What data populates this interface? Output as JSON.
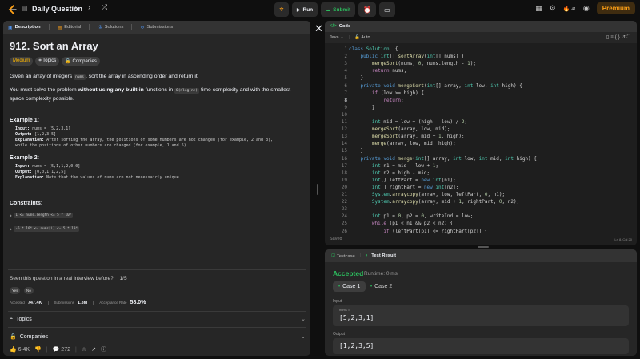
{
  "topbar": {
    "title": "Daily Question",
    "run_label": "Run",
    "submit_label": "Submit",
    "premium_label": "Premium",
    "streak_count": "41"
  },
  "left_tabs": [
    "Description",
    "Editorial",
    "Solutions",
    "Submissions"
  ],
  "problem": {
    "title": "912. Sort an Array",
    "difficulty": "Medium",
    "topics_label": "Topics",
    "companies_label": "Companies",
    "p1_a": "Given an array of integers ",
    "p1_code": "nums",
    "p1_b": ", sort the array in ascending order and return it.",
    "p2_a": "You must solve the problem ",
    "p2_bold": "without using any built-in",
    "p2_b": " functions in ",
    "p2_code": "O(nlog(n))",
    "p2_c": " time complexity and with the smallest space complexity possible.",
    "example1": {
      "heading": "Example 1:",
      "input_label": "Input:",
      "input": " nums = [5,2,3,1]",
      "output_label": "Output:",
      "output": " [1,2,3,5]",
      "explanation_label": "Explanation:",
      "explanation": " After sorting the array, the positions of some numbers are not changed (for example, 2 and 3),",
      "explanation2": "while the positions of other numbers are changed (for example, 1 and 5)."
    },
    "example2": {
      "heading": "Example 2:",
      "input_label": "Input:",
      "input": " nums = [5,1,1,2,0,0]",
      "output_label": "Output:",
      "output": " [0,0,1,1,2,5]",
      "explanation_label": "Explanation:",
      "explanation": " Note that the values of nums are not necessairly unique."
    },
    "constraints_heading": "Constraints:",
    "constraints": [
      "1 <= nums.length <= 5 * 10⁴",
      "-5 * 10⁴ <= nums[i] <= 5 * 10⁴"
    ],
    "seen_text": "Seen this question in a real interview before?",
    "seen_count": "1/5",
    "yes_label": "Yes",
    "no_label": "No",
    "accepted_label": "Accepted",
    "accepted_value": "747.4K",
    "submissions_label": "Submissions",
    "submissions_value": "1.3M",
    "rate_label": "Acceptance Rate",
    "rate_value": "58.0%",
    "topics_section": "Topics",
    "companies_section": "Companies",
    "likes": "6.4K",
    "comments": "272"
  },
  "editor": {
    "tab_label": "Code",
    "language": "Java",
    "autocomplete": "Auto",
    "status": "Saved",
    "cursor": "Ln 8, Col 20",
    "lines": [
      [
        [
          "k",
          "class "
        ],
        [
          "t",
          "Solution"
        ],
        [
          "",
          "  {"
        ]
      ],
      [
        [
          "",
          "    "
        ],
        [
          "k",
          "public "
        ],
        [
          "t",
          "int"
        ],
        [
          "",
          "[] "
        ],
        [
          "f",
          "sortArray"
        ],
        [
          "",
          "("
        ],
        [
          "t",
          "int"
        ],
        [
          "",
          "[] nums) {"
        ]
      ],
      [
        [
          "",
          "        "
        ],
        [
          "f",
          "mergeSort"
        ],
        [
          "",
          "(nums, "
        ],
        [
          "n",
          "0"
        ],
        [
          "",
          ", nums.length - "
        ],
        [
          "n",
          "1"
        ],
        [
          "",
          ");"
        ]
      ],
      [
        [
          "",
          "        "
        ],
        [
          "p",
          "return"
        ],
        [
          "",
          " nums;"
        ]
      ],
      [
        [
          "",
          "    }"
        ]
      ],
      [
        [
          "",
          "    "
        ],
        [
          "k",
          "private void "
        ],
        [
          "f",
          "mergeSort"
        ],
        [
          "",
          "("
        ],
        [
          "t",
          "int"
        ],
        [
          "",
          "[] array, "
        ],
        [
          "t",
          "int"
        ],
        [
          "",
          " low, "
        ],
        [
          "t",
          "int"
        ],
        [
          "",
          " high) {"
        ]
      ],
      [
        [
          "",
          "        "
        ],
        [
          "p",
          "if"
        ],
        [
          "",
          " (low >= high) {"
        ]
      ],
      [
        [
          "",
          "            "
        ],
        [
          "p",
          "return"
        ],
        [
          "",
          ";"
        ]
      ],
      [
        [
          "",
          "        }"
        ]
      ],
      [
        [
          "",
          ""
        ]
      ],
      [
        [
          "",
          "        "
        ],
        [
          "t",
          "int"
        ],
        [
          "",
          " mid = low + (high - low) / "
        ],
        [
          "n",
          "2"
        ],
        [
          "",
          ";"
        ]
      ],
      [
        [
          "",
          "        "
        ],
        [
          "f",
          "mergeSort"
        ],
        [
          "",
          "(array, low, mid);"
        ]
      ],
      [
        [
          "",
          "        "
        ],
        [
          "f",
          "mergeSort"
        ],
        [
          "",
          "(array, mid + "
        ],
        [
          "n",
          "1"
        ],
        [
          "",
          ", high);"
        ]
      ],
      [
        [
          "",
          "        "
        ],
        [
          "f",
          "merge"
        ],
        [
          "",
          "(array, low, mid, high);"
        ]
      ],
      [
        [
          "",
          "    }"
        ]
      ],
      [
        [
          "",
          "    "
        ],
        [
          "k",
          "private void "
        ],
        [
          "f",
          "merge"
        ],
        [
          "",
          "("
        ],
        [
          "t",
          "int"
        ],
        [
          "",
          "[] array, "
        ],
        [
          "t",
          "int"
        ],
        [
          "",
          " low, "
        ],
        [
          "t",
          "int"
        ],
        [
          "",
          " mid, "
        ],
        [
          "t",
          "int"
        ],
        [
          "",
          " high) {"
        ]
      ],
      [
        [
          "",
          "        "
        ],
        [
          "t",
          "int"
        ],
        [
          "",
          " n1 = mid - low + "
        ],
        [
          "n",
          "1"
        ],
        [
          "",
          ";"
        ]
      ],
      [
        [
          "",
          "        "
        ],
        [
          "t",
          "int"
        ],
        [
          "",
          " n2 = high - mid;"
        ]
      ],
      [
        [
          "",
          "        "
        ],
        [
          "t",
          "int"
        ],
        [
          "",
          "[] leftPart = "
        ],
        [
          "k",
          "new "
        ],
        [
          "t",
          "int"
        ],
        [
          "",
          "[n1];"
        ]
      ],
      [
        [
          "",
          "        "
        ],
        [
          "t",
          "int"
        ],
        [
          "",
          "[] rightPart = "
        ],
        [
          "k",
          "new "
        ],
        [
          "t",
          "int"
        ],
        [
          "",
          "[n2];"
        ]
      ],
      [
        [
          "",
          "        "
        ],
        [
          "t",
          "System"
        ],
        [
          "",
          "."
        ],
        [
          "f",
          "arraycopy"
        ],
        [
          "",
          "(array, low, leftPart, "
        ],
        [
          "n",
          "0"
        ],
        [
          "",
          ", n1);"
        ]
      ],
      [
        [
          "",
          "        "
        ],
        [
          "t",
          "System"
        ],
        [
          "",
          "."
        ],
        [
          "f",
          "arraycopy"
        ],
        [
          "",
          "(array, mid + "
        ],
        [
          "n",
          "1"
        ],
        [
          "",
          ", rightPart, "
        ],
        [
          "n",
          "0"
        ],
        [
          "",
          ", n2);"
        ]
      ],
      [
        [
          "",
          ""
        ]
      ],
      [
        [
          "",
          "        "
        ],
        [
          "t",
          "int"
        ],
        [
          "",
          " p1 = "
        ],
        [
          "n",
          "0"
        ],
        [
          "",
          ", p2 = "
        ],
        [
          "n",
          "0"
        ],
        [
          "",
          ", writeInd = low;"
        ]
      ],
      [
        [
          "",
          "        "
        ],
        [
          "p",
          "while"
        ],
        [
          "",
          " (p1 < n1 && p2 < n2) {"
        ]
      ],
      [
        [
          "",
          "            "
        ],
        [
          "p",
          "if"
        ],
        [
          "",
          " (leftPart[p1] <= rightPart[p2]) {"
        ]
      ]
    ]
  },
  "result": {
    "testcase_label": "Testcase",
    "result_label": "Test Result",
    "verdict": "Accepted",
    "runtime": "Runtime: 0 ms",
    "case1": "Case 1",
    "case2": "Case 2",
    "input_label": "Input",
    "input_var": "nums =",
    "input_value": "[5,2,3,1]",
    "output_label": "Output",
    "output_value": "[1,2,3,5]"
  },
  "colors": {
    "accent_green": "#2cbb5d",
    "accent_orange": "#ffa116",
    "medium": "#ffb800"
  }
}
